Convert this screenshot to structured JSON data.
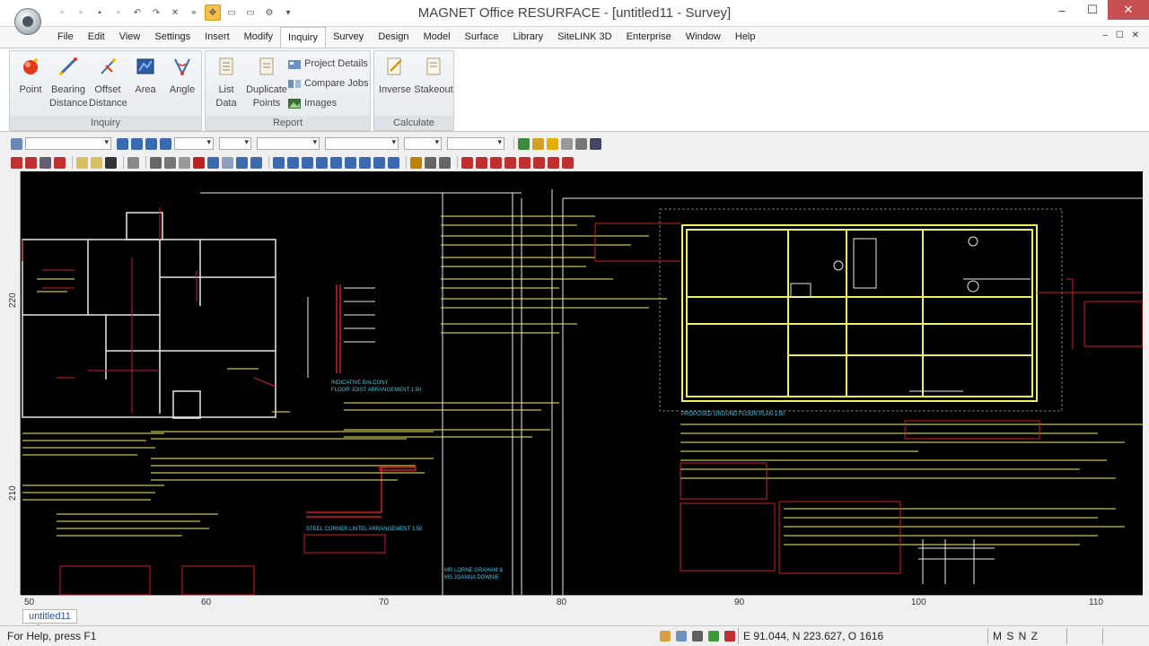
{
  "window": {
    "title": "MAGNET Office RESURFACE - [untitled11 - Survey]"
  },
  "menu": [
    "File",
    "Edit",
    "View",
    "Settings",
    "Insert",
    "Modify",
    "Inquiry",
    "Survey",
    "Design",
    "Model",
    "Surface",
    "Library",
    "SiteLINK 3D",
    "Enterprise",
    "Window",
    "Help"
  ],
  "menu_active": "Inquiry",
  "ribbon": {
    "inquiry": {
      "caption": "Inquiry",
      "point": "Point",
      "bearing_distance": [
        "Bearing",
        "Distance"
      ],
      "offset_distance": [
        "Offset",
        "Distance"
      ],
      "area": "Area",
      "angle": "Angle"
    },
    "report": {
      "caption": "Report",
      "list_data": [
        "List",
        "Data"
      ],
      "duplicate_points": [
        "Duplicate",
        "Points"
      ],
      "project_details": "Project Details",
      "compare_jobs": "Compare Jobs",
      "images": "Images"
    },
    "calculate": {
      "caption": "Calculate",
      "inverse": "Inverse",
      "stakeout": "Stakeout"
    }
  },
  "ruler": {
    "left": [
      {
        "label": "220"
      },
      {
        "label": "210"
      }
    ],
    "bottom": [
      "50",
      "60",
      "70",
      "80",
      "90",
      "100",
      "110"
    ]
  },
  "drawing_labels": {
    "balcony": [
      "INDICATIVE BALCONY",
      "FLOOR JOIST ARRANGEMENT 1:50"
    ],
    "lintel": "STEEL CORNER LINTEL ARRANGEMENT 1:50",
    "client": [
      "MR LORNE GRAHAM &",
      "MS JOANNA DOWNIE"
    ],
    "plan": "PROPOSED GROUND FLOOR PLAN 1:50"
  },
  "doc_tab": "untitled11 - Survey",
  "status": {
    "help": "For Help, press F1",
    "coords": "E 91.044,  N 223.627, O 1616",
    "mode": "M S N Z"
  },
  "colors": {
    "canvas": "#000000",
    "cad_yellow": "#f0f060",
    "cad_red": "#d02020",
    "cad_white": "#e8e8e8",
    "cad_cyan": "#40c8e8",
    "close": "#c75050"
  }
}
